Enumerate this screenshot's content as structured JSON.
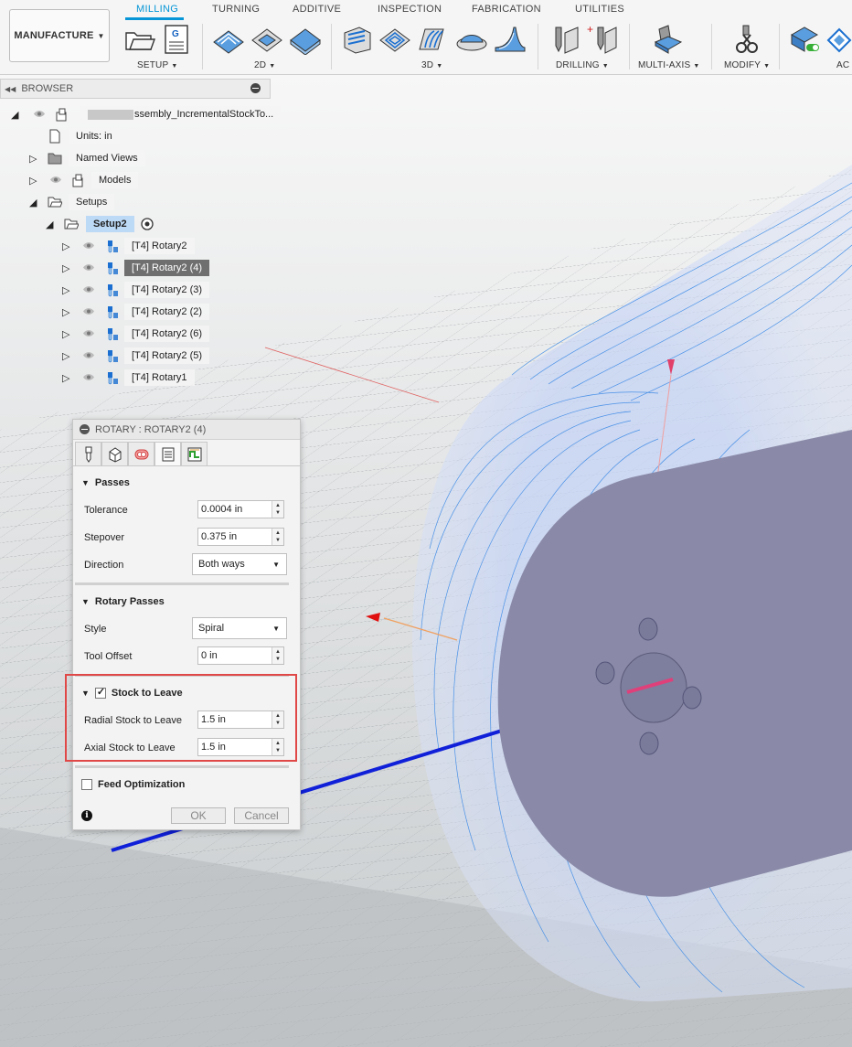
{
  "toolbar": {
    "workspace": "MANUFACTURE",
    "tabs": [
      "MILLING",
      "TURNING",
      "ADDITIVE",
      "INSPECTION",
      "FABRICATION",
      "UTILITIES"
    ],
    "groups": {
      "setup": "SETUP",
      "two_d": "2D",
      "three_d": "3D",
      "drilling": "DRILLING",
      "multi_axis": "MULTI-AXIS",
      "modify": "MODIFY",
      "actions": "AC"
    },
    "accent": "#0696d7"
  },
  "browser": {
    "title": "BROWSER",
    "root": "ssembly_IncrementalStockTo...",
    "units": "Units: in",
    "named_views": "Named Views",
    "models": "Models",
    "setups": "Setups",
    "setup_name": "Setup2",
    "operations": [
      "[T4] Rotary2",
      "[T4] Rotary2 (4)",
      "[T4] Rotary2 (3)",
      "[T4] Rotary2 (2)",
      "[T4] Rotary2 (6)",
      "[T4] Rotary2 (5)",
      "[T4] Rotary1"
    ],
    "selected_index": 1
  },
  "dialog": {
    "title": "ROTARY : ROTARY2 (4)",
    "passes": {
      "header": "Passes",
      "tolerance_label": "Tolerance",
      "tolerance": "0.0004 in",
      "stepover_label": "Stepover",
      "stepover": "0.375 in",
      "direction_label": "Direction",
      "direction": "Both ways"
    },
    "rotary_passes": {
      "header": "Rotary Passes",
      "style_label": "Style",
      "style": "Spiral",
      "tool_offset_label": "Tool Offset",
      "tool_offset": "0 in"
    },
    "stock": {
      "header": "Stock to Leave",
      "checked": true,
      "radial_label": "Radial Stock to Leave",
      "radial": "1.5 in",
      "axial_label": "Axial Stock to Leave",
      "axial": "1.5 in"
    },
    "feed": {
      "header": "Feed Optimization",
      "checked": false
    },
    "ok": "OK",
    "cancel": "Cancel",
    "info": "i"
  }
}
